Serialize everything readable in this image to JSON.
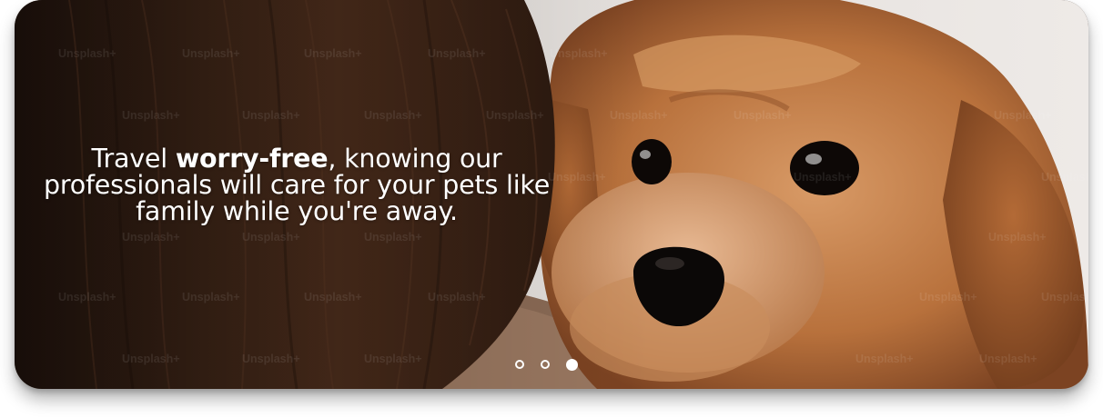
{
  "hero": {
    "tagline_before": "Travel ",
    "tagline_bold": "worry-free",
    "tagline_after": ", knowing our professionals will care for your pets like family while you're away.",
    "image_alt": "Fluffy brown dog resting on a person's shoulder",
    "watermark_text": "Unsplash+"
  },
  "carousel": {
    "slide_count": 3,
    "active_index": 2,
    "dot_icons": [
      "dot-icon",
      "dot-icon",
      "dot-active-icon"
    ]
  },
  "colors": {
    "text": "#ffffff",
    "hair": "#2b1a12",
    "fur": "#c07a45",
    "background": "#e9e5e2"
  }
}
